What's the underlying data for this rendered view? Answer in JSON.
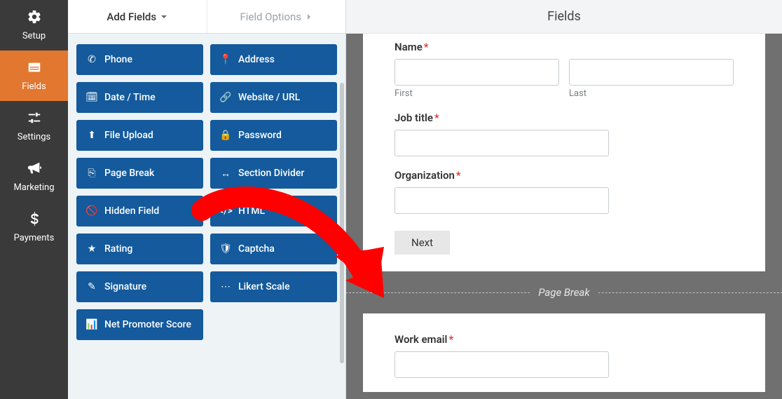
{
  "nav": {
    "items": [
      {
        "id": "setup",
        "label": "Setup"
      },
      {
        "id": "fields",
        "label": "Fields"
      },
      {
        "id": "settings",
        "label": "Settings"
      },
      {
        "id": "marketing",
        "label": "Marketing"
      },
      {
        "id": "payments",
        "label": "Payments"
      }
    ]
  },
  "tabs": {
    "add_fields": "Add Fields",
    "field_options": "Field Options"
  },
  "field_buttons": [
    {
      "icon": "phone",
      "label": "Phone"
    },
    {
      "icon": "address",
      "label": "Address"
    },
    {
      "icon": "date",
      "label": "Date / Time"
    },
    {
      "icon": "url",
      "label": "Website / URL"
    },
    {
      "icon": "upload",
      "label": "File Upload"
    },
    {
      "icon": "password",
      "label": "Password"
    },
    {
      "icon": "pagebreak",
      "label": "Page Break"
    },
    {
      "icon": "divider",
      "label": "Section Divider"
    },
    {
      "icon": "hidden",
      "label": "Hidden Field"
    },
    {
      "icon": "html",
      "label": "HTML"
    },
    {
      "icon": "rating",
      "label": "Rating"
    },
    {
      "icon": "captcha",
      "label": "Captcha"
    },
    {
      "icon": "signature",
      "label": "Signature"
    },
    {
      "icon": "likert",
      "label": "Likert Scale"
    },
    {
      "icon": "nps",
      "label": "Net Promoter Score"
    }
  ],
  "header": {
    "title": "Fields"
  },
  "form": {
    "name": {
      "label": "Name",
      "first": "First",
      "last": "Last"
    },
    "job_title": {
      "label": "Job title"
    },
    "organization": {
      "label": "Organization"
    },
    "next": "Next",
    "page_break": "Page Break",
    "work_email": {
      "label": "Work email"
    }
  },
  "colors": {
    "accent": "#e27730",
    "field_btn": "#145a9c",
    "arrow": "#ff0000"
  }
}
